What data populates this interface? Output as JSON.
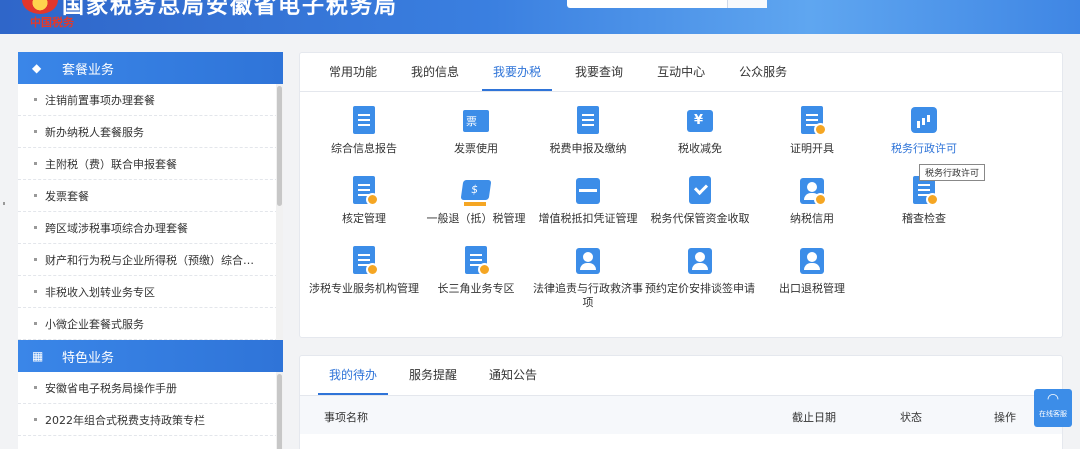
{
  "header": {
    "title": "国家税务总局安徽省电子税务局",
    "mark": "中国税务"
  },
  "left": {
    "section1": {
      "title": "套餐业务",
      "items": [
        "注销前置事项办理套餐",
        "新办纳税人套餐服务",
        "主附税（费）联合申报套餐",
        "发票套餐",
        "跨区域涉税事项综合办理套餐",
        "财产和行为税与企业所得税（预缴）综合…",
        "非税收入划转业务专区",
        "小微企业套餐式服务"
      ]
    },
    "section2": {
      "title": "特色业务",
      "items": [
        "安徽省电子税务局操作手册",
        "2022年组合式税费支持政策专栏"
      ]
    }
  },
  "main": {
    "tabs": [
      "常用功能",
      "我的信息",
      "我要办税",
      "我要查询",
      "互动中心",
      "公众服务"
    ],
    "active_tab": "我要办税",
    "rows": [
      [
        "综合信息报告",
        "发票使用",
        "税费申报及缴纳",
        "税收减免",
        "证明开具",
        "税务行政许可"
      ],
      [
        "核定管理",
        "一般退（抵）税管理",
        "增值税抵扣凭证管理",
        "税务代保管资金收取",
        "纳税信用",
        "稽查检查"
      ],
      [
        "涉税专业服务机构管理",
        "长三角业务专区",
        "法律追责与行政救济事项",
        "预约定价安排谈签申请",
        "出口退税管理"
      ]
    ],
    "tooltip": "税务行政许可"
  },
  "lower": {
    "tabs": [
      "我的待办",
      "服务提醒",
      "通知公告"
    ],
    "columns": {
      "name": "事项名称",
      "deadline": "截止日期",
      "status": "状态",
      "action": "操作"
    }
  },
  "float_help": {
    "label": "在线客服"
  }
}
